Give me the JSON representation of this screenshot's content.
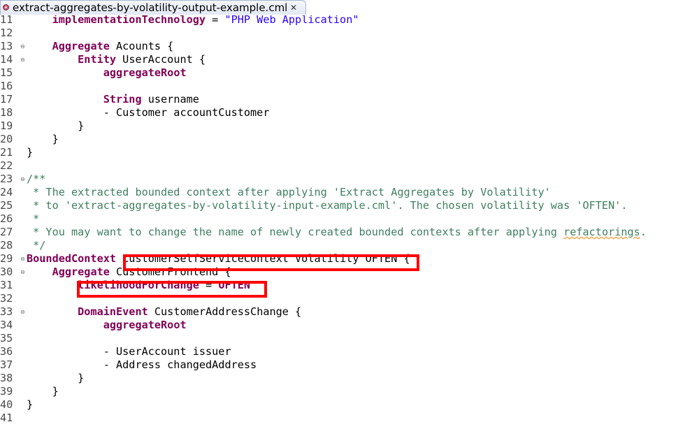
{
  "tab": {
    "title": "extract-aggregates-by-volatility-output-example.cml",
    "close_glyph": "✕",
    "icon": "cml-file-icon"
  },
  "editor": {
    "lines": [
      {
        "n": "11",
        "fold": false,
        "tokens": [
          {
            "t": "    ",
            "c": ""
          },
          {
            "t": "implementationTechnology",
            "c": "kw"
          },
          {
            "t": " = ",
            "c": ""
          },
          {
            "t": "\"PHP Web Application\"",
            "c": "str"
          }
        ]
      },
      {
        "n": "12",
        "fold": false,
        "tokens": []
      },
      {
        "n": "13",
        "fold": true,
        "tokens": [
          {
            "t": "    ",
            "c": ""
          },
          {
            "t": "Aggregate",
            "c": "kw"
          },
          {
            "t": " Acounts {",
            "c": ""
          }
        ]
      },
      {
        "n": "14",
        "fold": true,
        "tokens": [
          {
            "t": "        ",
            "c": ""
          },
          {
            "t": "Entity",
            "c": "kw"
          },
          {
            "t": " UserAccount {",
            "c": ""
          }
        ]
      },
      {
        "n": "15",
        "fold": false,
        "tokens": [
          {
            "t": "            ",
            "c": ""
          },
          {
            "t": "aggregateRoot",
            "c": "kw"
          }
        ]
      },
      {
        "n": "16",
        "fold": false,
        "tokens": []
      },
      {
        "n": "17",
        "fold": false,
        "tokens": [
          {
            "t": "            ",
            "c": ""
          },
          {
            "t": "String",
            "c": "kw"
          },
          {
            "t": " username",
            "c": ""
          }
        ]
      },
      {
        "n": "18",
        "fold": false,
        "tokens": [
          {
            "t": "            - Customer accountCustomer",
            "c": ""
          }
        ]
      },
      {
        "n": "19",
        "fold": false,
        "tokens": [
          {
            "t": "        }",
            "c": ""
          }
        ]
      },
      {
        "n": "20",
        "fold": false,
        "tokens": [
          {
            "t": "    }",
            "c": ""
          }
        ]
      },
      {
        "n": "21",
        "fold": false,
        "tokens": [
          {
            "t": "}",
            "c": ""
          }
        ]
      },
      {
        "n": "22",
        "fold": false,
        "tokens": []
      },
      {
        "n": "23",
        "fold": true,
        "tokens": [
          {
            "t": "/**",
            "c": "cm"
          }
        ]
      },
      {
        "n": "24",
        "fold": false,
        "tokens": [
          {
            "t": " * The extracted bounded context after applying 'Extract Aggregates by Volatility'",
            "c": "cm"
          }
        ]
      },
      {
        "n": "25",
        "fold": false,
        "tokens": [
          {
            "t": " * to 'extract-aggregates-by-volatility-input-example.cml'. The chosen volatility was 'OFTEN'.",
            "c": "cm"
          }
        ]
      },
      {
        "n": "26",
        "fold": false,
        "tokens": [
          {
            "t": " *",
            "c": "cm"
          }
        ]
      },
      {
        "n": "27",
        "fold": false,
        "tokens": [
          {
            "t": " * You may want to change the name of newly created bounded contexts after applying ",
            "c": "cm"
          },
          {
            "t": "refactorings",
            "c": "cm squig"
          },
          {
            "t": ".",
            "c": "cm"
          }
        ]
      },
      {
        "n": "28",
        "fold": false,
        "tokens": [
          {
            "t": " */",
            "c": "cm"
          }
        ]
      },
      {
        "n": "29",
        "fold": true,
        "tokens": [
          {
            "t": "BoundedContext",
            "c": "kw"
          },
          {
            "t": " CustomerSelfServiceContext Volatility OFTEN {",
            "c": ""
          }
        ]
      },
      {
        "n": "30",
        "fold": true,
        "tokens": [
          {
            "t": "    ",
            "c": ""
          },
          {
            "t": "Aggregate",
            "c": "kw"
          },
          {
            "t": " CustomerFrontend {",
            "c": ""
          }
        ]
      },
      {
        "n": "31",
        "fold": false,
        "tokens": [
          {
            "t": "        ",
            "c": ""
          },
          {
            "t": "likelihoodForChange",
            "c": "kw"
          },
          {
            "t": " = ",
            "c": ""
          },
          {
            "t": "OFTEN",
            "c": "kw"
          }
        ]
      },
      {
        "n": "32",
        "fold": false,
        "tokens": []
      },
      {
        "n": "33",
        "fold": true,
        "tokens": [
          {
            "t": "        ",
            "c": ""
          },
          {
            "t": "DomainEvent",
            "c": "kw"
          },
          {
            "t": " CustomerAddressChange {",
            "c": ""
          }
        ]
      },
      {
        "n": "34",
        "fold": false,
        "tokens": [
          {
            "t": "            ",
            "c": ""
          },
          {
            "t": "aggregateRoot",
            "c": "kw"
          }
        ]
      },
      {
        "n": "35",
        "fold": false,
        "tokens": []
      },
      {
        "n": "36",
        "fold": false,
        "tokens": [
          {
            "t": "            - UserAccount issuer",
            "c": ""
          }
        ]
      },
      {
        "n": "37",
        "fold": false,
        "tokens": [
          {
            "t": "            - Address changedAddress",
            "c": ""
          }
        ]
      },
      {
        "n": "38",
        "fold": false,
        "tokens": [
          {
            "t": "        }",
            "c": ""
          }
        ]
      },
      {
        "n": "39",
        "fold": false,
        "tokens": [
          {
            "t": "    }",
            "c": ""
          }
        ]
      },
      {
        "n": "40",
        "fold": false,
        "tokens": [
          {
            "t": "}",
            "c": ""
          }
        ]
      },
      {
        "n": "41",
        "fold": false,
        "tokens": []
      }
    ]
  },
  "colors": {
    "keyword": "#7f0055",
    "string": "#2a00ff",
    "comment": "#3f7f5f",
    "highlight_box": "#ff0000"
  }
}
